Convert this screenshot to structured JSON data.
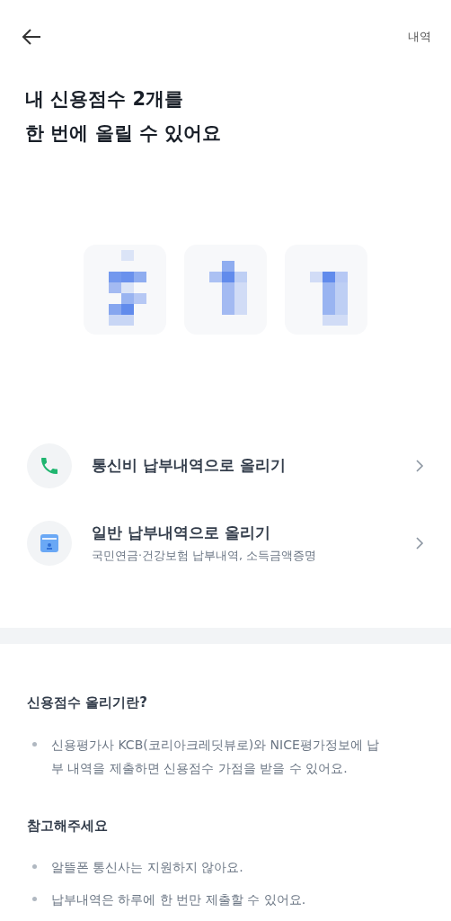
{
  "header": {
    "action": "내역"
  },
  "title_lines": [
    "내 신용점수 2개를",
    "한 번에 올릴 수 있어요"
  ],
  "score_cards": [
    {
      "kind": "picture"
    },
    {
      "kind": "picture"
    },
    {
      "kind": "picture"
    }
  ],
  "options": [
    {
      "kind": "phone",
      "title": "통신비 납부내역으로 올리기"
    },
    {
      "kind": "document",
      "title": "일반 납부내역으로 올리기",
      "subtitle": "국민연금·건강보험 납부내역, 소득금액증명"
    }
  ],
  "info_sections": [
    {
      "heading": "신용점수 올리기란?",
      "bullets": [
        "신용평가사 KCB(코리아크레딧뷰로)와 NICE평가정보에 납부 내역을 제출하면 신용점수 가점을 받을 수 있어요."
      ]
    },
    {
      "heading": "참고해주세요",
      "bullets": [
        "알뜰폰 통신사는 지원하지 않아요.",
        "납부내역은 하루에 한 번만 제출할 수 있어요."
      ]
    }
  ]
}
